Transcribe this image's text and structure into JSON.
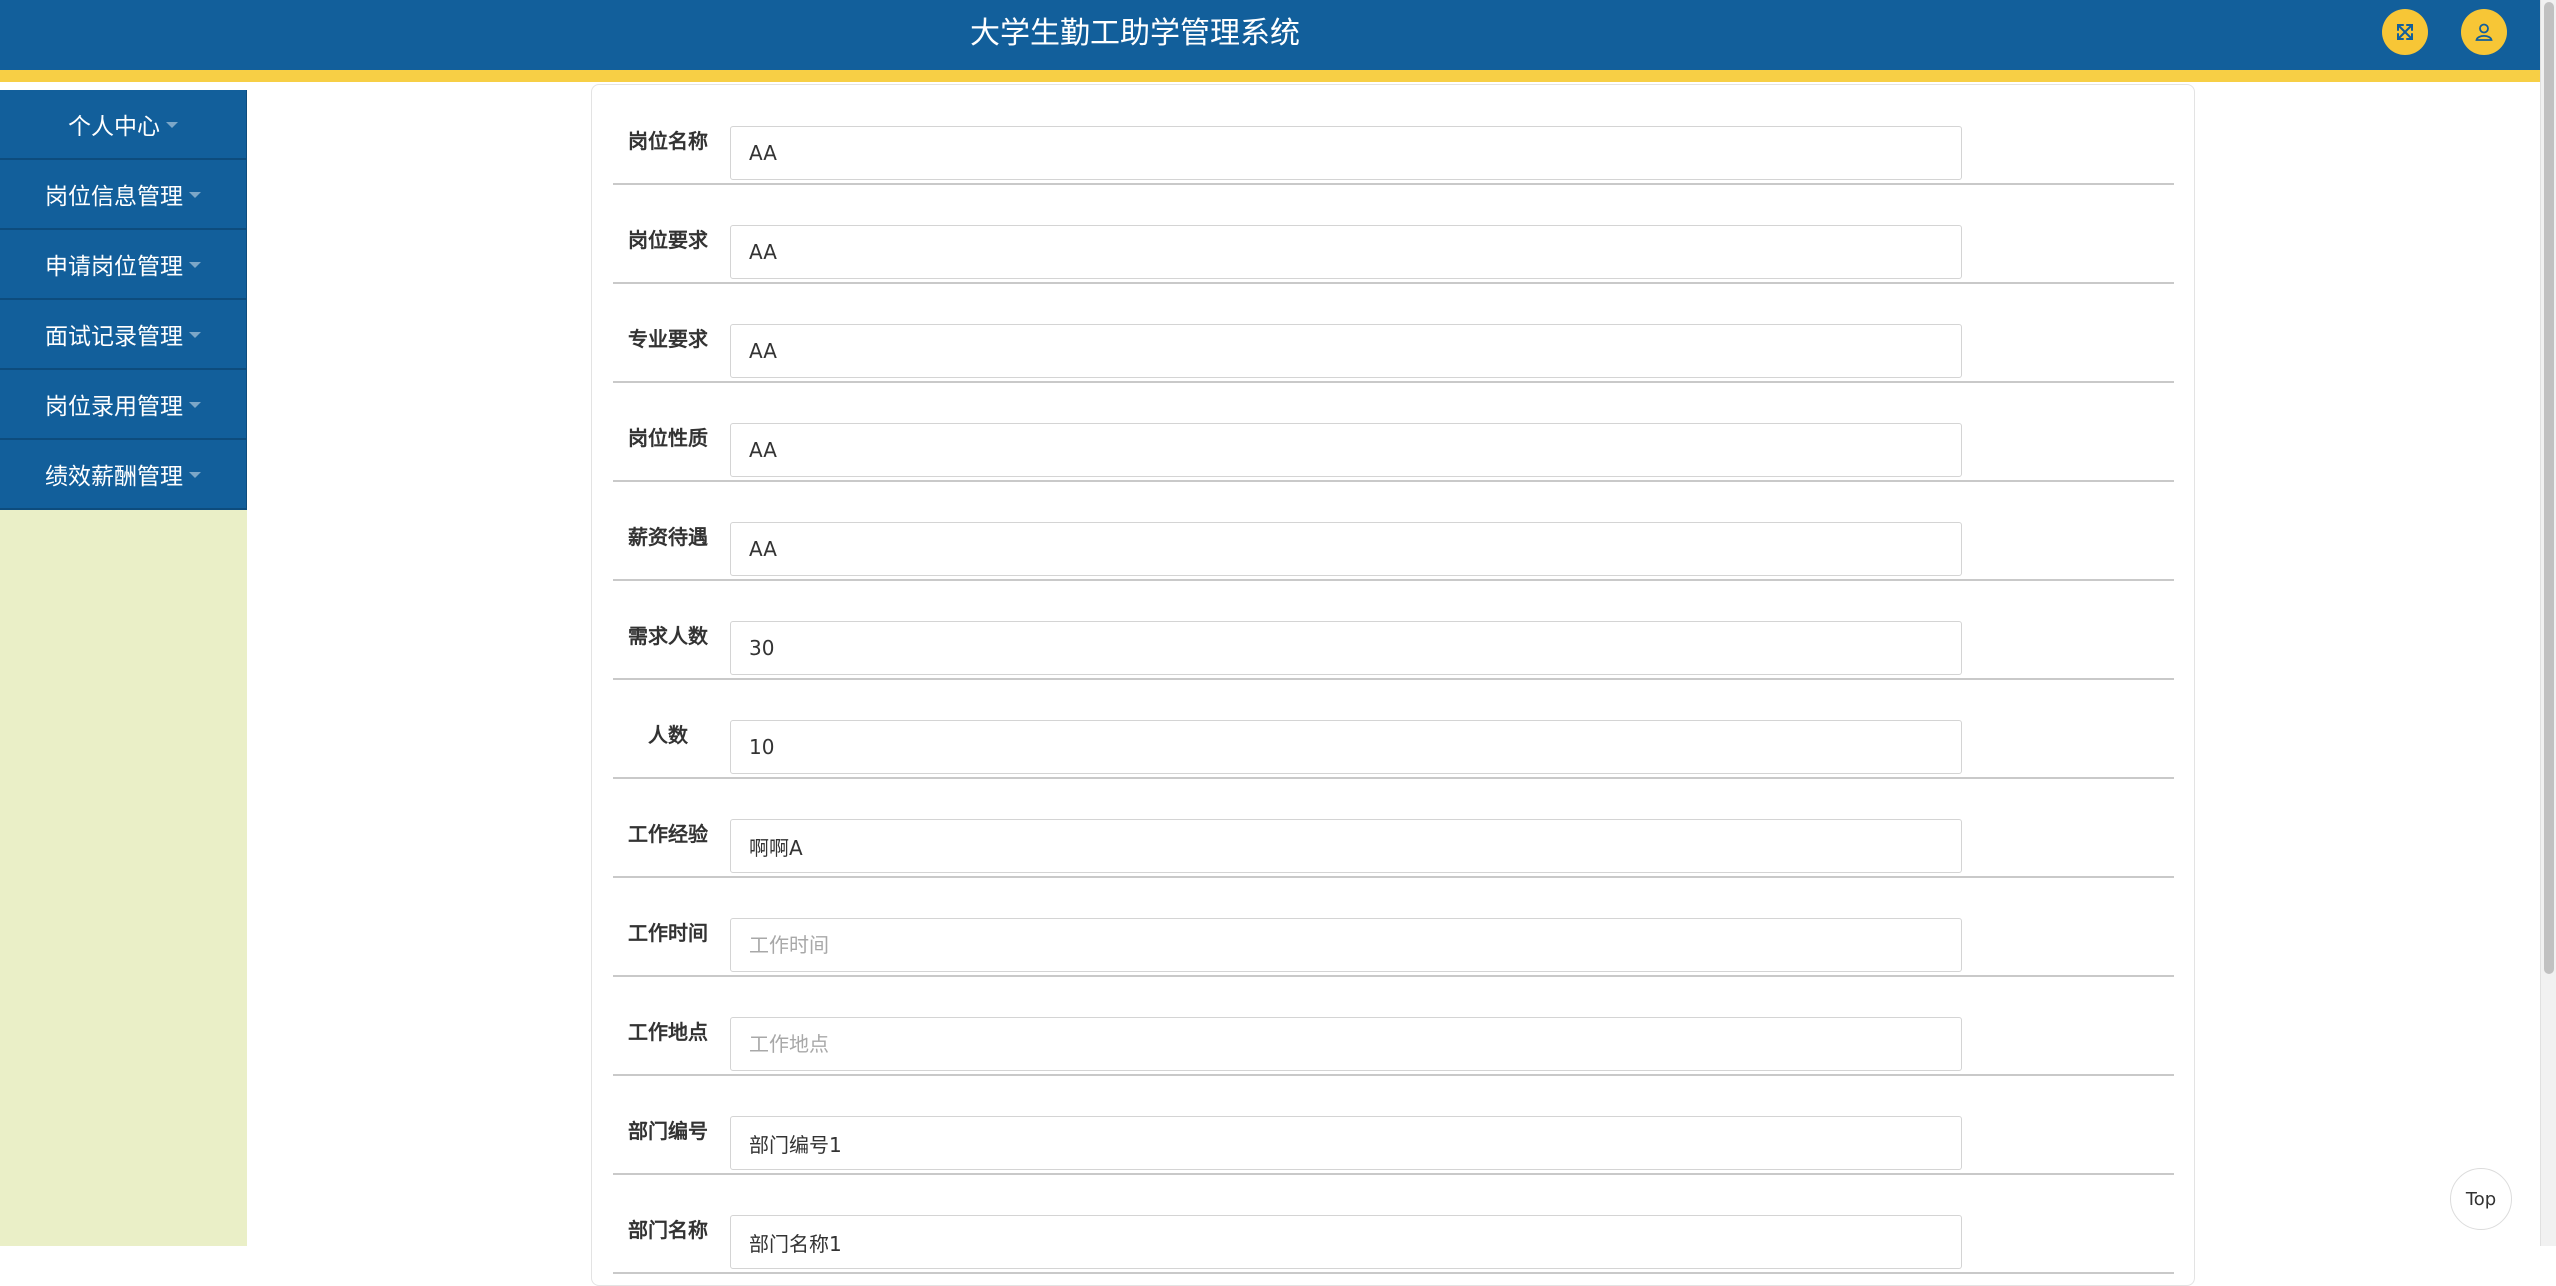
{
  "header": {
    "title": "大学生勤工助学管理系统",
    "fullscreen_icon": "expand-icon",
    "user_icon": "user-icon"
  },
  "sidebar": {
    "items": [
      {
        "label": "个人中心"
      },
      {
        "label": "岗位信息管理"
      },
      {
        "label": "申请岗位管理"
      },
      {
        "label": "面试记录管理"
      },
      {
        "label": "岗位录用管理"
      },
      {
        "label": "绩效薪酬管理"
      }
    ]
  },
  "form": {
    "fields": [
      {
        "label": "岗位名称",
        "value": "AA",
        "placeholder": "岗位名称"
      },
      {
        "label": "岗位要求",
        "value": "AA",
        "placeholder": "岗位要求"
      },
      {
        "label": "专业要求",
        "value": "AA",
        "placeholder": "专业要求"
      },
      {
        "label": "岗位性质",
        "value": "AA",
        "placeholder": "岗位性质"
      },
      {
        "label": "薪资待遇",
        "value": "AA",
        "placeholder": "薪资待遇"
      },
      {
        "label": "需求人数",
        "value": "30",
        "placeholder": "需求人数"
      },
      {
        "label": "人数",
        "value": "10",
        "placeholder": "人数"
      },
      {
        "label": "工作经验",
        "value": "啊啊A",
        "placeholder": "工作经验"
      },
      {
        "label": "工作时间",
        "value": "",
        "placeholder": "工作时间"
      },
      {
        "label": "工作地点",
        "value": "",
        "placeholder": "工作地点"
      },
      {
        "label": "部门编号",
        "value": "部门编号1",
        "placeholder": "部门编号"
      },
      {
        "label": "部门名称",
        "value": "部门名称1",
        "placeholder": "部门名称"
      }
    ]
  },
  "top_button": {
    "label": "Top"
  },
  "colors": {
    "header_bg": "#125f9b",
    "accent_strip": "#f7cf45",
    "sidebar_bg": "#eaefc7",
    "icon_button": "#f7c636"
  }
}
